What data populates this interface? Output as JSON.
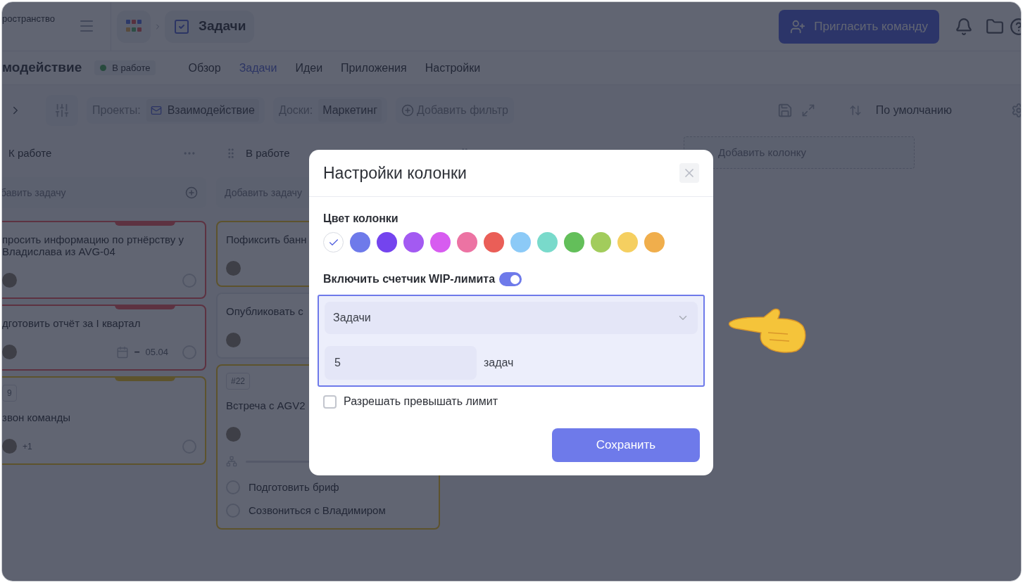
{
  "workspace": {
    "label": "ространство"
  },
  "app_tab": {
    "label": "Задачи"
  },
  "invite_button": {
    "label": "Пригласить команду"
  },
  "project": {
    "name": "модействие",
    "status": "В работе"
  },
  "nav_tabs": [
    {
      "label": "Обзор",
      "selected": false
    },
    {
      "label": "Задачи",
      "selected": true
    },
    {
      "label": "Идеи",
      "selected": false
    },
    {
      "label": "Приложения",
      "selected": false
    },
    {
      "label": "Настройки",
      "selected": false
    }
  ],
  "filters": [
    {
      "label": "Проекты:",
      "value": "Взаимодействие",
      "kind": "project"
    },
    {
      "label": "Доски:",
      "value": "Маркетинг",
      "kind": "board"
    }
  ],
  "add_filter": "Добавить фильтр",
  "sort": "По умолчанию",
  "columns": [
    {
      "title": "К работе",
      "add_task": "бавить задачу",
      "cards": [
        {
          "title": "просить информацию по ртнёрству у Владислава из AVG-04",
          "kind": "high",
          "flag": true
        },
        {
          "title": "дготовить отчёт за I квартал",
          "kind": "high",
          "flag": true,
          "dates": {
            "start": "–",
            "end": "05.04"
          }
        },
        {
          "tag": "9",
          "title": "звон команды",
          "kind": "medium",
          "flag": true,
          "extra": "+1"
        }
      ]
    },
    {
      "title": "В работе",
      "add_task": "Добавить задачу",
      "cards": [
        {
          "title": "Пофиксить банн",
          "kind": "medium",
          "flag": false
        },
        {
          "title": "Опубликовать с",
          "kind": "plain",
          "flag": false
        },
        {
          "tag": "#22",
          "title": "Встреча с AGV2",
          "kind": "medium",
          "flag": false,
          "subtasks": {
            "level": 0
          },
          "checklist": [
            {
              "label": "Подготовить бриф",
              "checked": false
            },
            {
              "label": "Созвониться с Владимиром",
              "checked": false
            }
          ]
        }
      ]
    }
  ],
  "add_column": "Добавить колонку",
  "dialog": {
    "title": "Настройки колонки",
    "color_label": "Цвет колонки",
    "swatches": [
      {
        "color": "#ffffff",
        "selected": true
      },
      {
        "color": "#6e7aea",
        "selected": false
      },
      {
        "color": "#7444ee",
        "selected": false
      },
      {
        "color": "#a35af2",
        "selected": false
      },
      {
        "color": "#d75cf0",
        "selected": false
      },
      {
        "color": "#ec73a3",
        "selected": false
      },
      {
        "color": "#ea5e57",
        "selected": false
      },
      {
        "color": "#8ccaf7",
        "selected": false
      },
      {
        "color": "#79dacb",
        "selected": false
      },
      {
        "color": "#63bf5a",
        "selected": false
      },
      {
        "color": "#a2cc5c",
        "selected": false
      },
      {
        "color": "#f5cf60",
        "selected": false
      },
      {
        "color": "#f0ae4c",
        "selected": false
      }
    ],
    "wip_label": "Включить счетчик WIP-лимита",
    "wip_on": true,
    "limit_type": "Задачи",
    "limit_value": "5",
    "limit_unit": "задач",
    "allow_exceed": {
      "label": "Разрешать превышать лимит",
      "checked": false
    },
    "save": "Сохранить"
  }
}
